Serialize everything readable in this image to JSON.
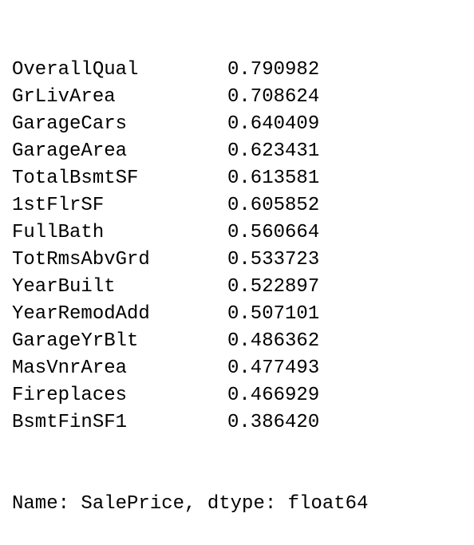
{
  "series": {
    "rows": [
      {
        "name": "OverallQual",
        "value": "0.790982"
      },
      {
        "name": "GrLivArea",
        "value": "0.708624"
      },
      {
        "name": "GarageCars",
        "value": "0.640409"
      },
      {
        "name": "GarageArea",
        "value": "0.623431"
      },
      {
        "name": "TotalBsmtSF",
        "value": "0.613581"
      },
      {
        "name": "1stFlrSF",
        "value": "0.605852"
      },
      {
        "name": "FullBath",
        "value": "0.560664"
      },
      {
        "name": "TotRmsAbvGrd",
        "value": "0.533723"
      },
      {
        "name": "YearBuilt",
        "value": "0.522897"
      },
      {
        "name": "YearRemodAdd",
        "value": "0.507101"
      },
      {
        "name": "GarageYrBlt",
        "value": "0.486362"
      },
      {
        "name": "MasVnrArea",
        "value": "0.477493"
      },
      {
        "name": "Fireplaces",
        "value": "0.466929"
      },
      {
        "name": "BsmtFinSF1",
        "value": "0.386420"
      }
    ],
    "footer": "Name: SalePrice, dtype: float64"
  }
}
